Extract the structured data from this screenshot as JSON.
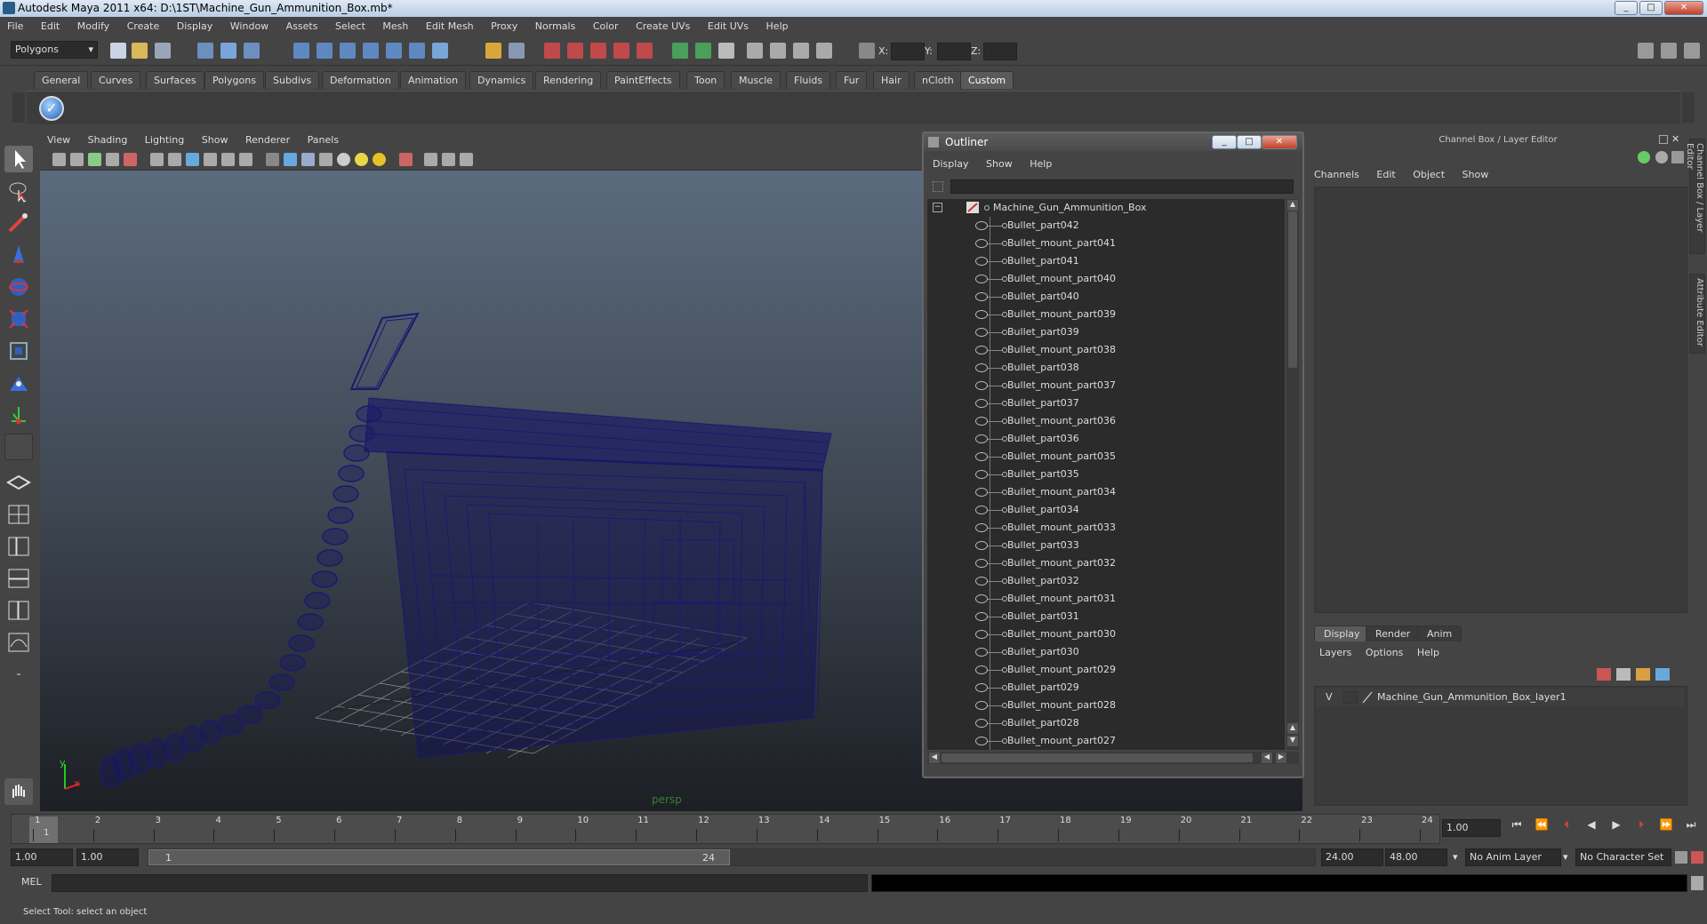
{
  "window": {
    "title": "Autodesk Maya 2011 x64: D:\\1ST\\Machine_Gun_Ammunition_Box.mb*"
  },
  "menubar": [
    "File",
    "Edit",
    "Modify",
    "Create",
    "Display",
    "Window",
    "Assets",
    "Select",
    "Mesh",
    "Edit Mesh",
    "Proxy",
    "Normals",
    "Color",
    "Create UVs",
    "Edit UVs",
    "Help"
  ],
  "statusline": {
    "mode": "Polygons",
    "x_label": "X:",
    "y_label": "Y:",
    "z_label": "Z:"
  },
  "shelf_tabs": [
    "General",
    "Curves",
    "Surfaces",
    "Polygons",
    "Subdivs",
    "Deformation",
    "Animation",
    "Dynamics",
    "Rendering",
    "PaintEffects",
    "Toon",
    "Muscle",
    "Fluids",
    "Fur",
    "Hair",
    "nCloth",
    "Custom"
  ],
  "shelf_active": "Custom",
  "viewport": {
    "menu": [
      "View",
      "Shading",
      "Lighting",
      "Show",
      "Renderer",
      "Panels"
    ],
    "camera_label": "persp",
    "axis": {
      "x": "x",
      "y": "y"
    }
  },
  "outliner": {
    "title": "Outliner",
    "menu": [
      "Display",
      "Show",
      "Help"
    ],
    "root": "Machine_Gun_Ammunition_Box",
    "items": [
      "Bullet_part042",
      "Bullet_mount_part041",
      "Bullet_part041",
      "Bullet_mount_part040",
      "Bullet_part040",
      "Bullet_mount_part039",
      "Bullet_part039",
      "Bullet_mount_part038",
      "Bullet_part038",
      "Bullet_mount_part037",
      "Bullet_part037",
      "Bullet_mount_part036",
      "Bullet_part036",
      "Bullet_mount_part035",
      "Bullet_part035",
      "Bullet_mount_part034",
      "Bullet_part034",
      "Bullet_mount_part033",
      "Bullet_part033",
      "Bullet_mount_part032",
      "Bullet_part032",
      "Bullet_mount_part031",
      "Bullet_part031",
      "Bullet_mount_part030",
      "Bullet_part030",
      "Bullet_mount_part029",
      "Bullet_part029",
      "Bullet_mount_part028",
      "Bullet_part028",
      "Bullet_mount_part027"
    ]
  },
  "channelbox": {
    "title": "Channel Box / Layer Editor",
    "menu": [
      "Channels",
      "Edit",
      "Object",
      "Show"
    ],
    "layer_tabs": [
      "Display",
      "Render",
      "Anim"
    ],
    "layer_menu": [
      "Layers",
      "Options",
      "Help"
    ],
    "layer": {
      "visibility": "V",
      "name": "Machine_Gun_Ammunition_Box_layer1"
    },
    "side_tabs": [
      "Channel Box / Layer Editor",
      "Attribute Editor"
    ]
  },
  "timeslider": {
    "ticks": [
      "1",
      "2",
      "3",
      "4",
      "5",
      "6",
      "7",
      "8",
      "9",
      "10",
      "11",
      "12",
      "13",
      "14",
      "15",
      "16",
      "17",
      "18",
      "19",
      "20",
      "21",
      "22",
      "23",
      "24"
    ],
    "current": "1",
    "current_frame_field": "1.00"
  },
  "range": {
    "start": "1.00",
    "playback_start": "1.00",
    "range_start_label": "1",
    "range_end_label": "24",
    "playback_end": "24.00",
    "end": "48.00",
    "anim_layer": "No Anim Layer",
    "character_set": "No Character Set"
  },
  "cmdline": {
    "label": "MEL"
  },
  "helpline": {
    "text": "Select Tool: select an object"
  }
}
